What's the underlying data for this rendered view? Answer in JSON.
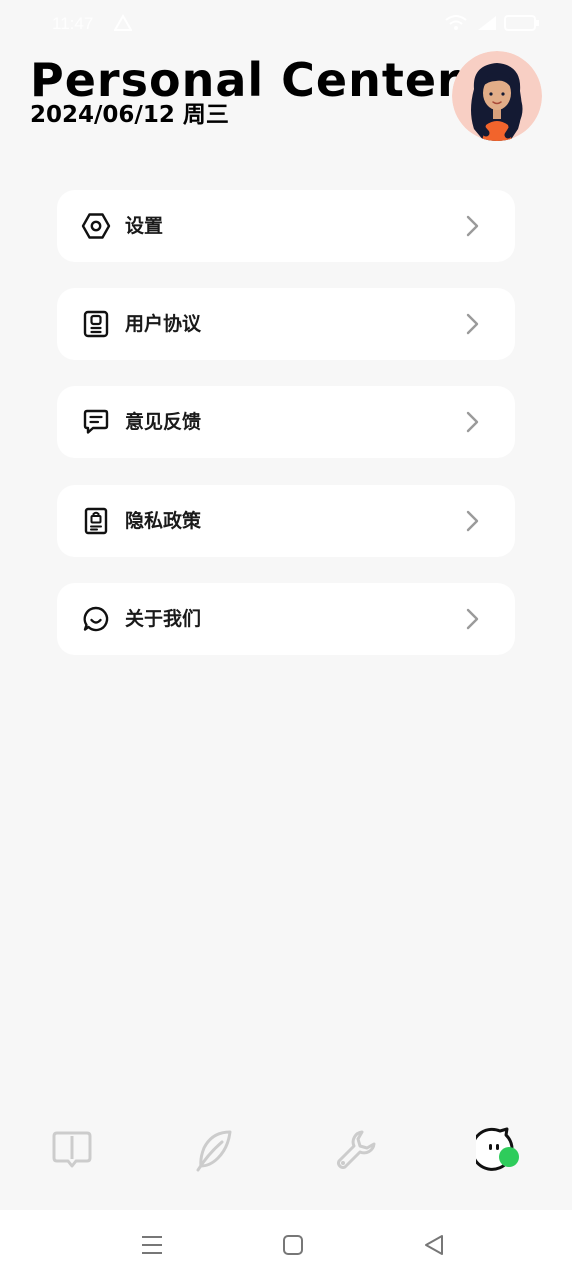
{
  "status_bar": {
    "time": "11:47"
  },
  "header": {
    "title": "Personal Center",
    "date": "2024/06/12 周三"
  },
  "menu": {
    "items": [
      {
        "label": "设置",
        "icon": "settings-hexagon-icon"
      },
      {
        "label": "用户协议",
        "icon": "user-agreement-icon"
      },
      {
        "label": "意见反馈",
        "icon": "feedback-message-icon"
      },
      {
        "label": "隐私政策",
        "icon": "privacy-policy-icon"
      },
      {
        "label": "关于我们",
        "icon": "about-us-chat-icon"
      }
    ]
  },
  "tab_bar": {
    "tabs": [
      {
        "icon": "book-icon",
        "active": false
      },
      {
        "icon": "feather-icon",
        "active": false
      },
      {
        "icon": "wrench-icon",
        "active": false
      },
      {
        "icon": "mascot-profile-icon",
        "active": true
      }
    ]
  },
  "colors": {
    "background": "#f7f7f7",
    "card": "#ffffff",
    "text": "#111111",
    "inactive_icon": "#c9c9c9",
    "accent_green": "#2ecc5b",
    "avatar_bg": "#f8cfc4"
  }
}
